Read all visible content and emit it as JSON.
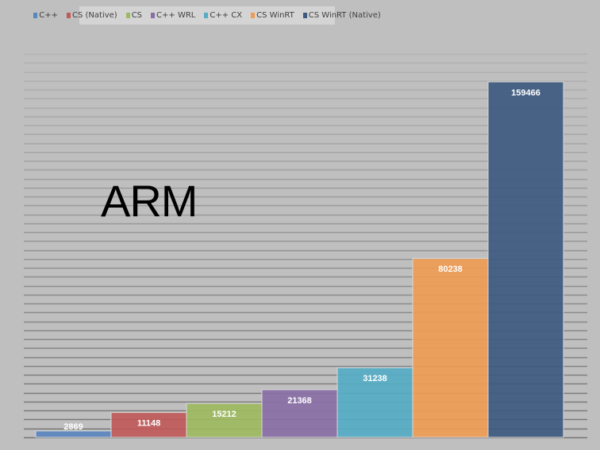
{
  "chart_data": {
    "type": "bar",
    "title": "",
    "annotation": "ARM",
    "categories": [
      "C++",
      "CS (Native)",
      "CS",
      "C++ WRL",
      "C++ CX",
      "CS WinRT",
      "CS WinRT (Native)"
    ],
    "values": [
      2869,
      11148,
      15212,
      21368,
      31238,
      80238,
      159466
    ],
    "labels": [
      "2869",
      "11148",
      "15212",
      "21368",
      "31238",
      "80238",
      "159466"
    ],
    "colors": [
      "#5a86bf",
      "#c05a59",
      "#9dba60",
      "#8a6fa6",
      "#55adc4",
      "#ef9c55",
      "#3e5a80"
    ],
    "ylim": [
      0,
      172000
    ],
    "grid_step": 4000,
    "grid": true,
    "legend_position": "top",
    "xlabel": "",
    "ylabel": ""
  }
}
